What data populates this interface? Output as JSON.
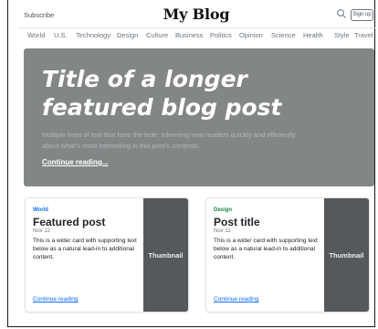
{
  "header": {
    "subscribe_label": "Subscribe",
    "brand": "My Blog",
    "search_icon": "search-icon",
    "signup_label": "Sign up"
  },
  "nav": {
    "items": [
      "World",
      "U.S.",
      "Technology",
      "Design",
      "Culture",
      "Business",
      "Politics",
      "Opinion",
      "Science",
      "Health",
      "Style",
      "Travel"
    ]
  },
  "hero": {
    "title": "Title of a longer featured blog post",
    "lede": "Multiple lines of text that form the lede, informing new readers quickly and efficiently about what's most interesting in this post's contents.",
    "link_label": "Continue reading..."
  },
  "cards": [
    {
      "category": "World",
      "category_color": "#0d6efd",
      "title": "Featured post",
      "date": "Nov 12",
      "text": "This is a wider card with supporting text below as a natural lead-in to additional content.",
      "link_label": "Continue reading",
      "thumbnail_label": "Thumbnail"
    },
    {
      "category": "Design",
      "category_color": "#198754",
      "title": "Post title",
      "date": "Nov 11",
      "text": "This is a wider card with supporting text below as a natural lead-in to additional content.",
      "link_label": "Continue reading",
      "thumbnail_label": "Thumbnail"
    }
  ],
  "colors": {
    "hero_bg": "#838687",
    "thumbnail_bg": "#55595c",
    "link": "#0d6efd"
  }
}
